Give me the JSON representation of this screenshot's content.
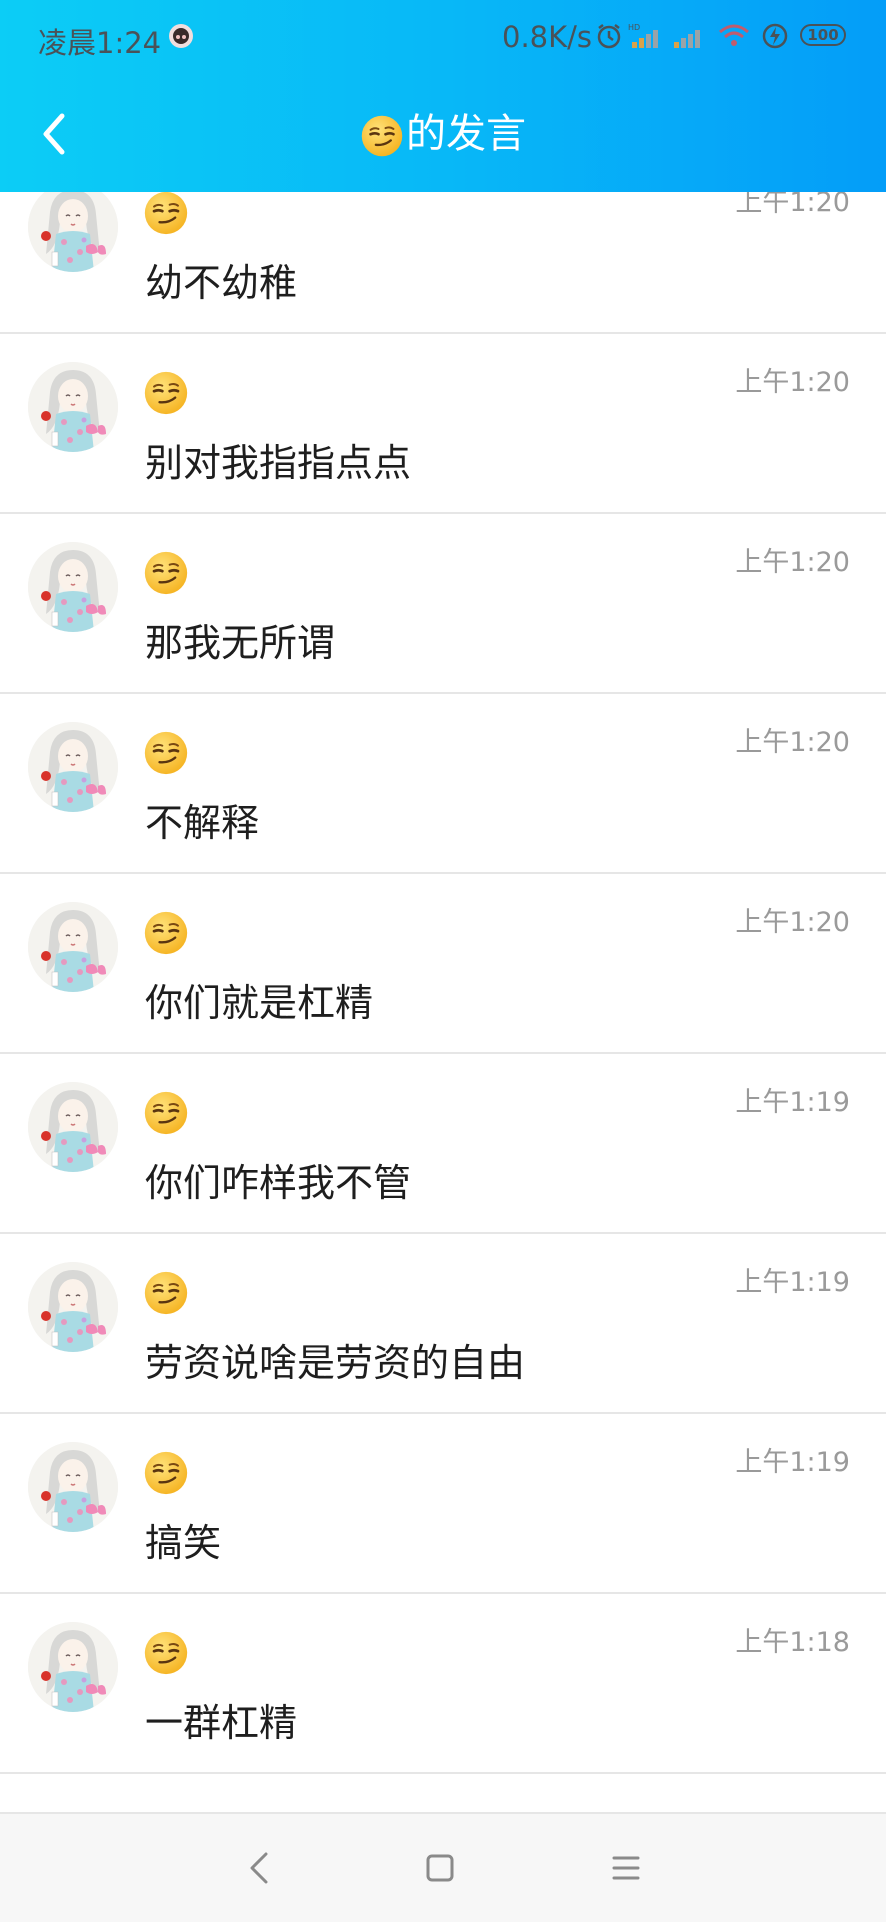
{
  "status_bar": {
    "time": "凌晨1:24",
    "network_speed": "0.8K/s",
    "battery": "100",
    "icons": [
      "notification-avatar-icon",
      "alarm-icon",
      "signal-hd-icon",
      "signal-icon",
      "wifi-icon",
      "charging-icon",
      "battery-icon"
    ]
  },
  "header": {
    "title_emoji": "smirk-emoji-icon",
    "title": "的发言",
    "back_icon": "chevron-left-icon",
    "background_colors": [
      "#0ccdf6",
      "#049df8"
    ]
  },
  "messages": [
    {
      "text": "幼不幼稚",
      "time": "上午1:20"
    },
    {
      "text": "别对我指指点点",
      "time": "上午1:20"
    },
    {
      "text": "那我无所谓",
      "time": "上午1:20"
    },
    {
      "text": "不解释",
      "time": "上午1:20"
    },
    {
      "text": "你们就是杠精",
      "time": "上午1:20"
    },
    {
      "text": "你们咋样我不管",
      "time": "上午1:19"
    },
    {
      "text": "劳资说啥是劳资的自由",
      "time": "上午1:19"
    },
    {
      "text": "搞笑",
      "time": "上午1:19"
    },
    {
      "text": "一群杠精",
      "time": "上午1:18"
    }
  ],
  "bottom_nav": {
    "icons": [
      "back-triangle-icon",
      "home-square-icon",
      "menu-icon"
    ]
  }
}
